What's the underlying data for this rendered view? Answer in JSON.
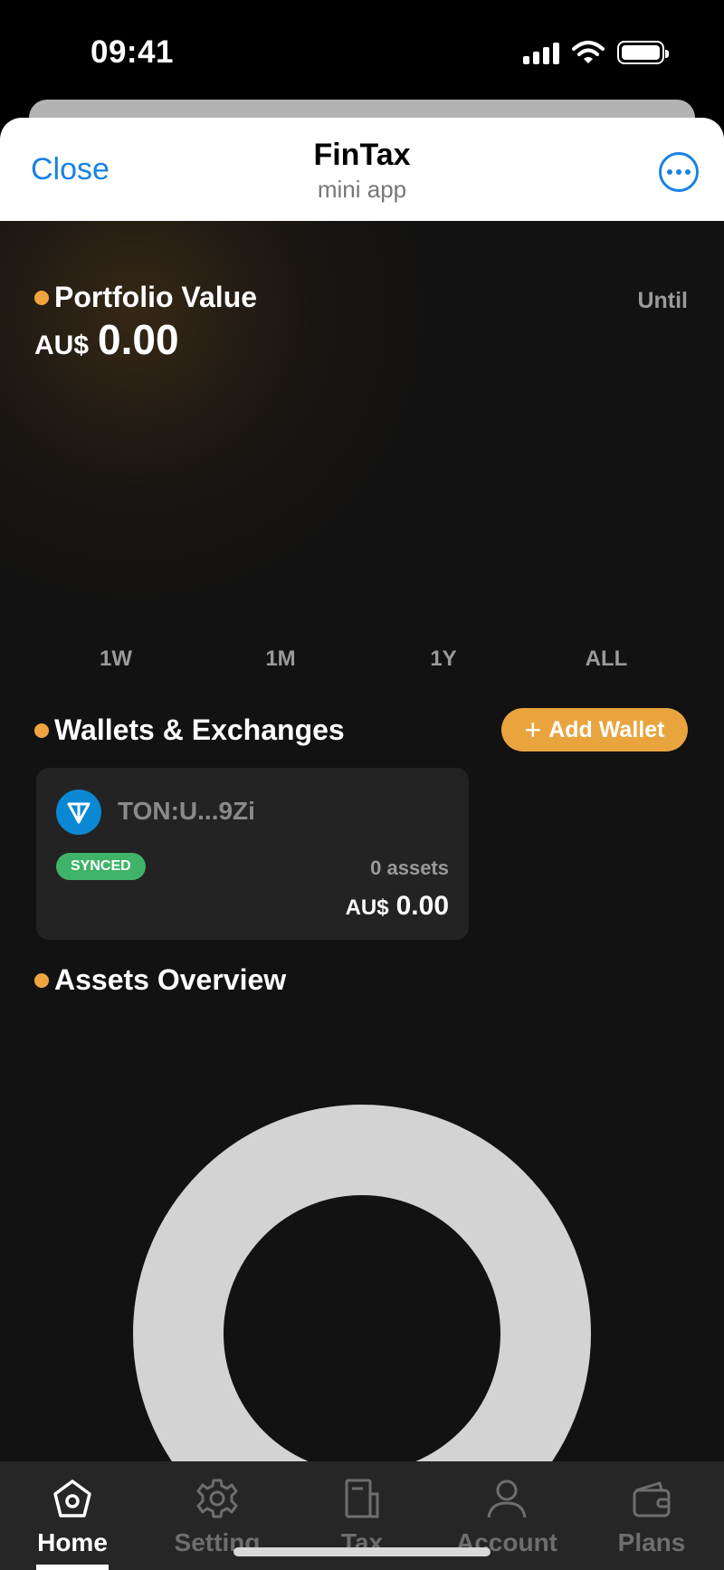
{
  "status_bar": {
    "time": "09:41"
  },
  "header": {
    "close_label": "Close",
    "title": "FinTax",
    "subtitle": "mini app",
    "more_icon": "ellipsis-circle-icon"
  },
  "portfolio": {
    "title": "Portfolio Value",
    "until_label": "Until",
    "currency": "AU$",
    "amount": "0.00",
    "ranges": [
      "1W",
      "1M",
      "1Y",
      "ALL"
    ]
  },
  "wallets": {
    "title": "Wallets & Exchanges",
    "add_wallet_label": "Add Wallet",
    "items": [
      {
        "name": "TON:U...9Zi",
        "icon": "ton-icon",
        "status": "SYNCED",
        "assets": "0 assets",
        "currency": "AU$",
        "amount": "0.00"
      }
    ]
  },
  "assets": {
    "title": "Assets Overview"
  },
  "nav": {
    "items": [
      {
        "label": "Home",
        "icon": "home-icon",
        "active": true
      },
      {
        "label": "Setting",
        "icon": "gear-icon",
        "active": false
      },
      {
        "label": "Tax",
        "icon": "document-icon",
        "active": false
      },
      {
        "label": "Account",
        "icon": "user-icon",
        "active": false
      },
      {
        "label": "Plans",
        "icon": "wallet-icon",
        "active": false
      }
    ]
  },
  "colors": {
    "accent": "#f0a440",
    "button": "#e9a43e",
    "link": "#1a82e2",
    "synced": "#3fb368",
    "ton": "#0a88d4"
  }
}
